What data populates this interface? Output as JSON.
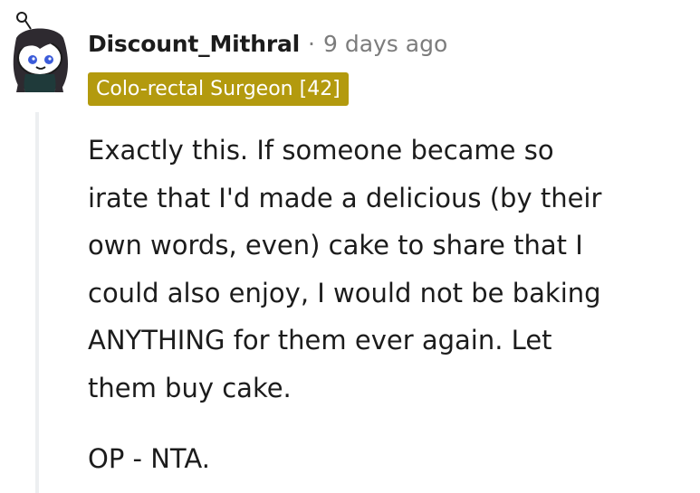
{
  "comment": {
    "author": "Discount_Mithral",
    "separator": "·",
    "time_ago": "9 days ago",
    "flair": "Colo-rectal Surgeon [42]",
    "paragraphs": [
      "Exactly this. If someone became so\nirate that I'd made a delicious (by their\nown words, even) cake to share that I\ncould also enjoy, I would not be baking\nANYTHING for them ever again. Let\nthem buy cake.",
      "OP - NTA."
    ]
  },
  "colors": {
    "flair_bg": "#b39a0e",
    "text": "#1c1c1c",
    "meta": "#7c7c7c",
    "thread_line": "#edeff1"
  },
  "icons": {
    "avatar": "snoo-avatar-icon"
  }
}
